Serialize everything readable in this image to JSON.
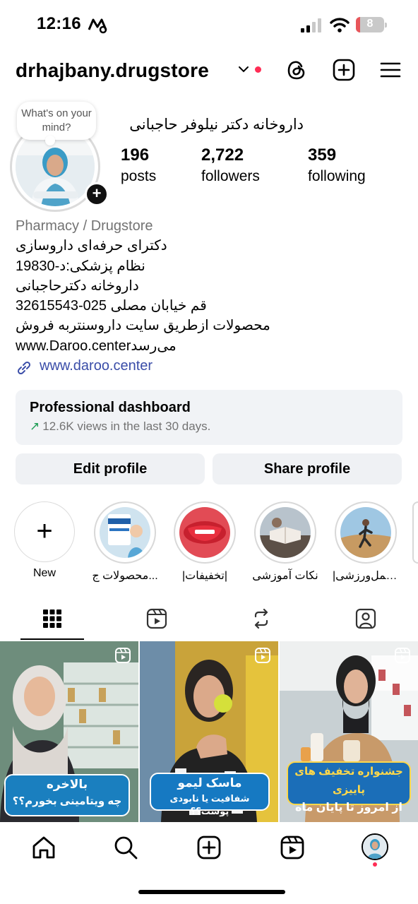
{
  "status_bar": {
    "time": "12:16",
    "battery_level": "8",
    "battery_fraction": 0.08
  },
  "header": {
    "username": "drhajbany.drugstore"
  },
  "profile": {
    "note": "What's on your mind?",
    "full_name": "داروخانه دکتر نیلوفر حاجبانی",
    "stats": [
      {
        "value": "196",
        "label": "posts"
      },
      {
        "value": "2,722",
        "label": "followers"
      },
      {
        "value": "359",
        "label": "following"
      }
    ]
  },
  "bio": {
    "category": "Pharmacy / Drugstore",
    "lines": [
      "دکترای حرفه‌ای داروسازی",
      "نظام پزشکی:د-19830",
      "داروخانه دکترحاجبانی",
      "قم خیابان مصلی 025-32615543",
      "محصولات ازطریق سایت داروسنتربه فروش",
      "www.Daroo.centerمی‌رسد"
    ],
    "link": "www.daroo.center"
  },
  "dashboard": {
    "title": "Professional dashboard",
    "subtitle": "12.6K views in the last 30 days."
  },
  "buttons": {
    "edit": "Edit profile",
    "share": "Share profile"
  },
  "highlights": [
    {
      "label": "New"
    },
    {
      "label": "محصولات ج..."
    },
    {
      "label": "|تخفیفات|"
    },
    {
      "label": "نکات آموزشی"
    },
    {
      "label": "|مکمل‌ورزشی|"
    }
  ],
  "posts": [
    {
      "caption_line1": "بالاخره",
      "caption_line2": "چه ویتامینی بخورم؟؟"
    },
    {
      "caption_line1": "ماسک لیمو",
      "caption_line2": "شفافیت یا نابودی پوست؟؟"
    },
    {
      "caption_line1": "جشنواره تخفیف های پاییزی",
      "caption_line2": "از امروز تا پایان ماه"
    }
  ],
  "colors": {
    "link": "#3a4da8",
    "badge_red": "#ff2d55",
    "trend_green": "#1f9d55",
    "card_bg": "#f1f3f6"
  }
}
